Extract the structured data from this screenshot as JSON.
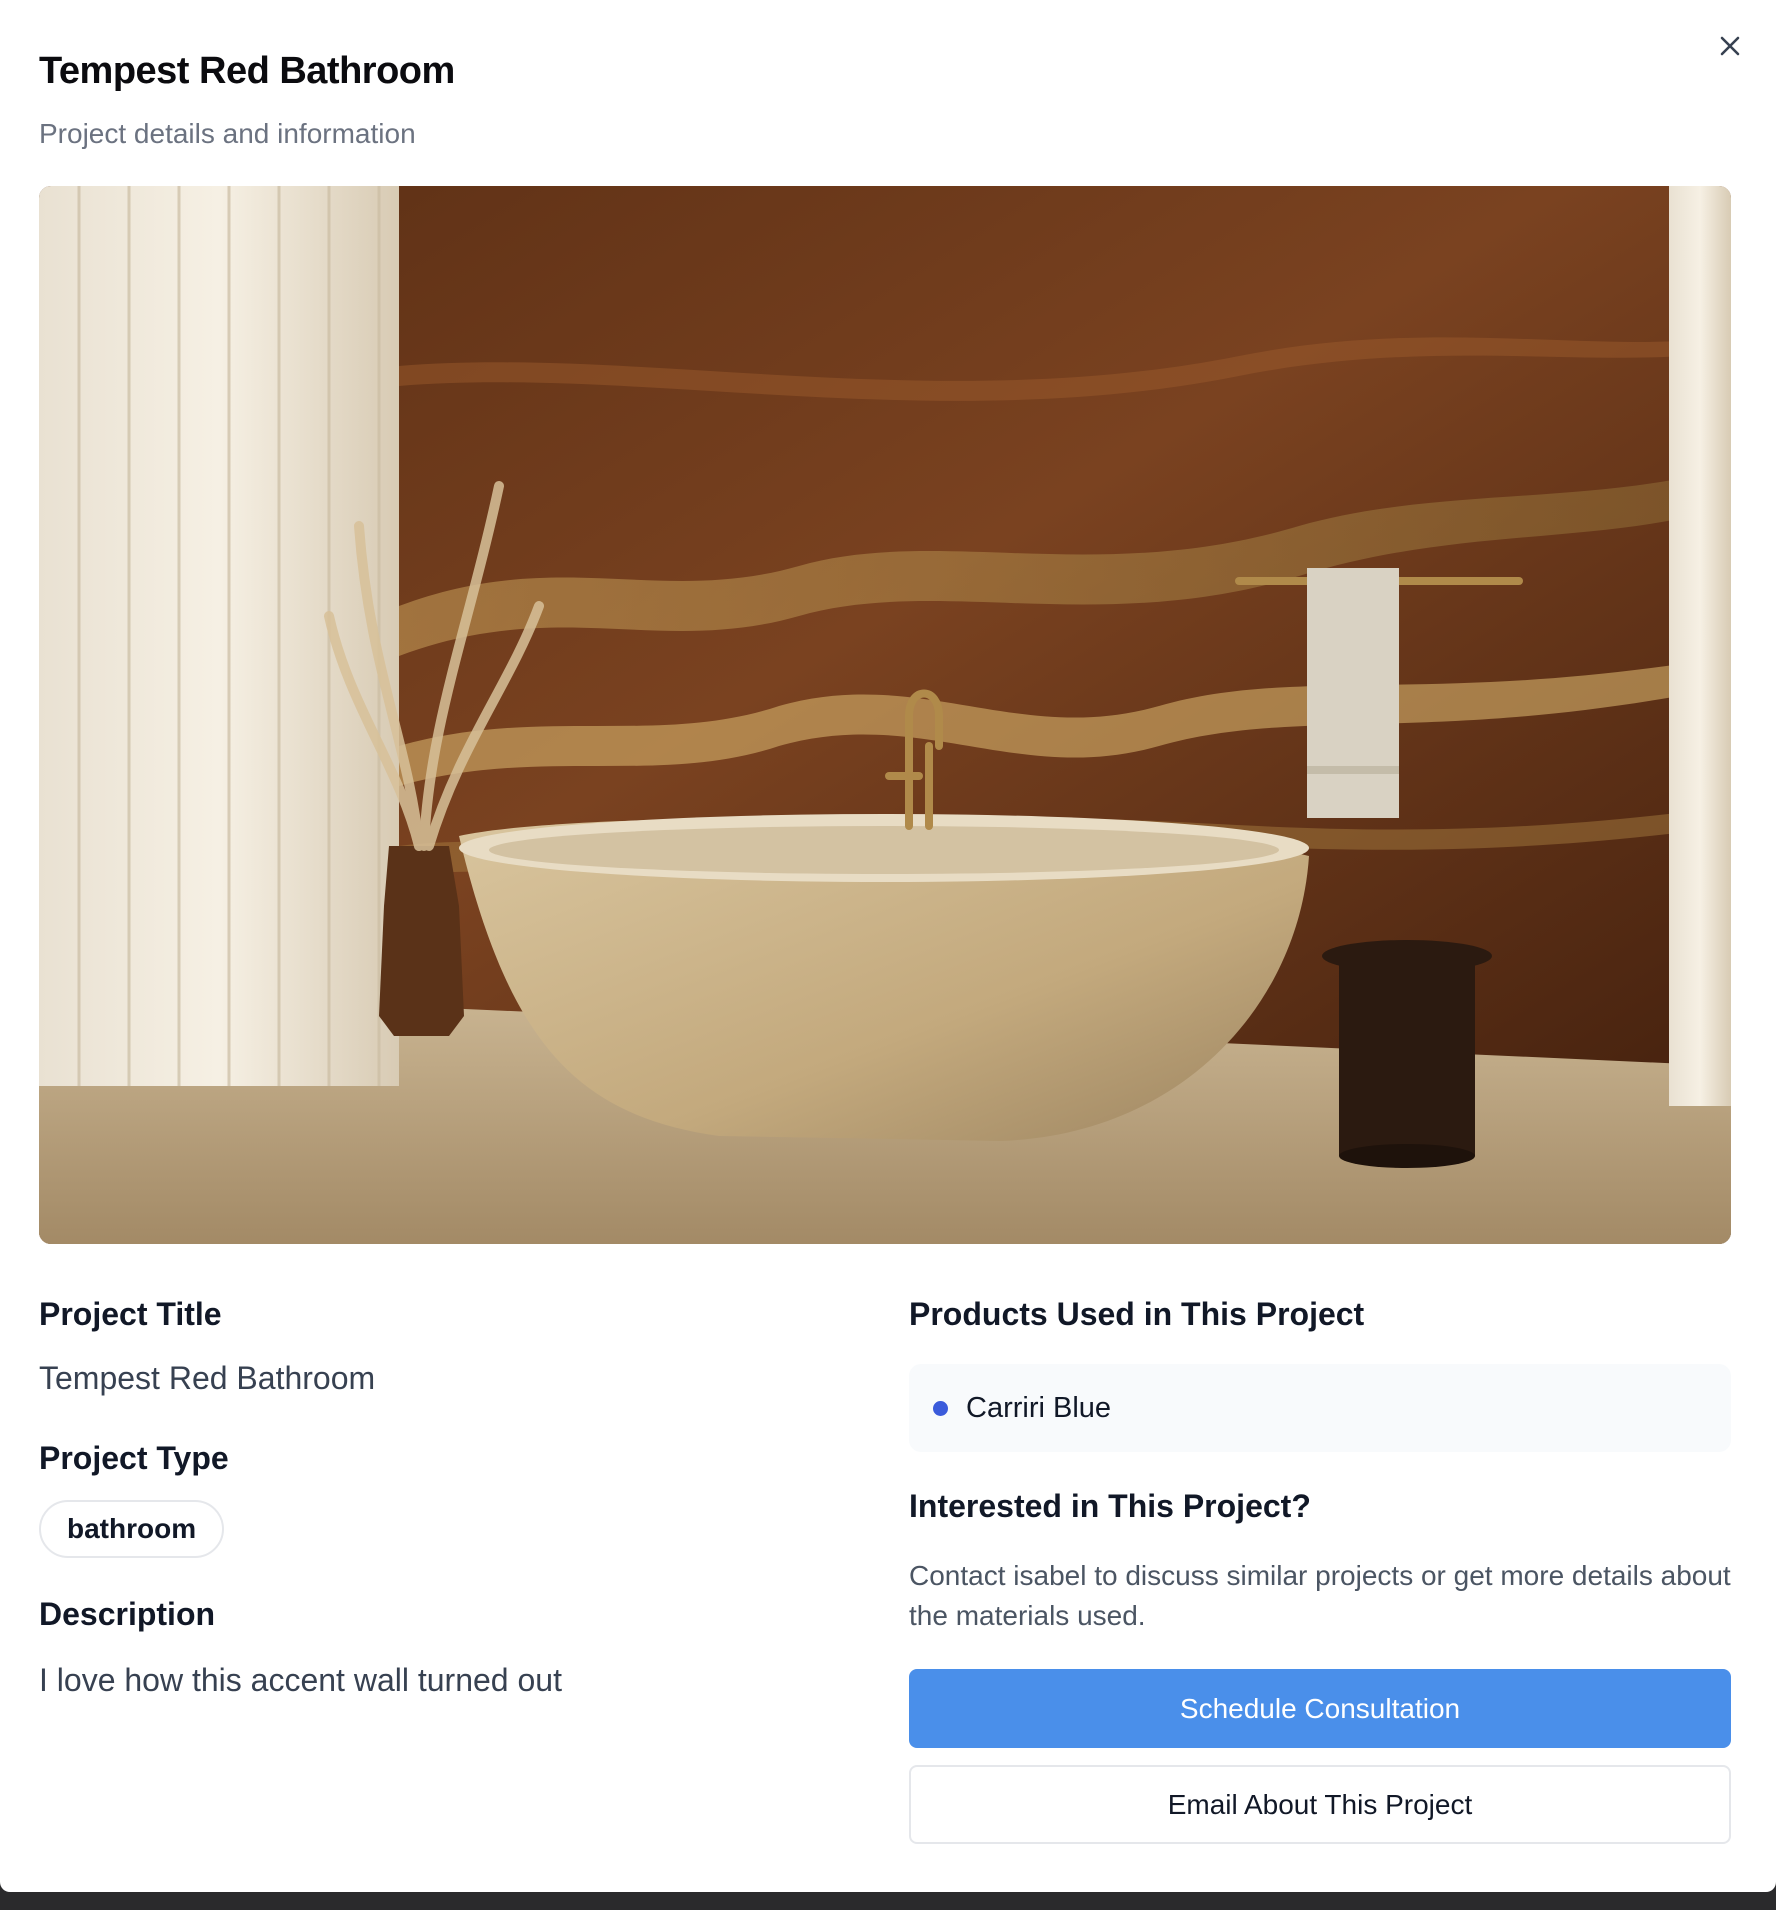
{
  "dialog": {
    "title": "Tempest Red Bathroom",
    "subtitle": "Project details and information"
  },
  "icons": {
    "close": "close-icon"
  },
  "details": {
    "project_title_label": "Project Title",
    "project_title_value": "Tempest Red Bathroom",
    "project_type_label": "Project Type",
    "project_type_value": "bathroom",
    "description_label": "Description",
    "description_value": "I love how this accent wall turned out"
  },
  "products": {
    "heading": "Products Used in This Project",
    "items": [
      {
        "name": "Carriri Blue",
        "dot_color": "#3b5bdb"
      }
    ]
  },
  "contact": {
    "heading": "Interested in This Project?",
    "text": "Contact isabel to discuss similar projects or get more details about the materials used.",
    "primary_button": "Schedule Consultation",
    "secondary_button": "Email About This Project"
  },
  "colors": {
    "primary": "#4a8fea",
    "border": "#e5e7eb"
  }
}
